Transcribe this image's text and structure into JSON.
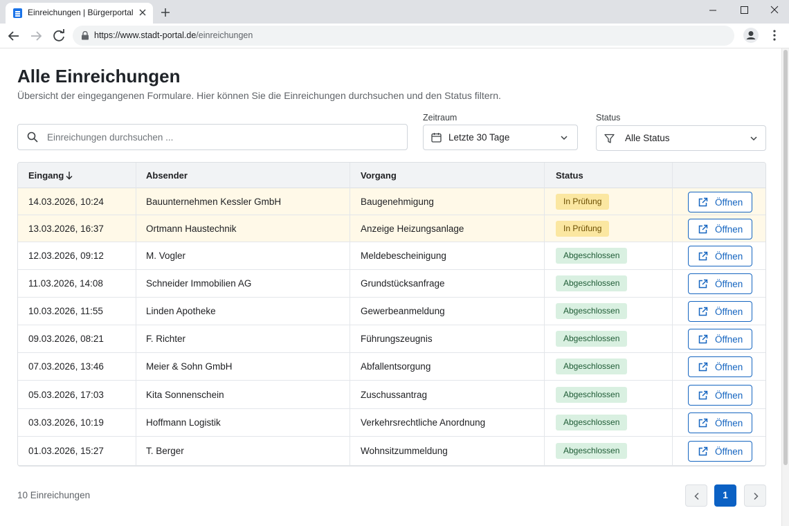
{
  "browser": {
    "tab_title": "Einreichungen | Bürgerportal",
    "url_host": "https://www.stadt-portal.de",
    "url_path": "/einreichungen"
  },
  "page": {
    "title": "Alle Einreichungen",
    "subtitle": "Übersicht der eingegangenen Formulare. Hier können Sie die Einreichungen durchsuchen und den Status filtern."
  },
  "filters": {
    "search_placeholder": "Einreichungen durchsuchen ...",
    "zeitraum_label": "Zeitraum",
    "zeitraum_value": "Letzte 30 Tage",
    "status_label": "Status",
    "status_value": "Alle Status"
  },
  "table": {
    "columns": [
      "Eingang",
      "Absender",
      "Vorgang",
      "Status"
    ],
    "open_label": "Öffnen",
    "rows": [
      {
        "date": "14.03.2026, 10:24",
        "sender": "Bauunternehmen Kessler GmbH",
        "process": "Baugenehmigung",
        "status": "In Prüfung"
      },
      {
        "date": "13.03.2026, 16:37",
        "sender": "Ortmann Haustechnik",
        "process": "Anzeige Heizungsanlage",
        "status": "In Prüfung"
      },
      {
        "date": "12.03.2026, 09:12",
        "sender": "M. Vogler",
        "process": "Meldebescheinigung",
        "status": "Abgeschlossen"
      },
      {
        "date": "11.03.2026, 14:08",
        "sender": "Schneider Immobilien AG",
        "process": "Grundstücksanfrage",
        "status": "Abgeschlossen"
      },
      {
        "date": "10.03.2026, 11:55",
        "sender": "Linden Apotheke",
        "process": "Gewerbeanmeldung",
        "status": "Abgeschlossen"
      },
      {
        "date": "09.03.2026, 08:21",
        "sender": "F. Richter",
        "process": "Führungszeugnis",
        "status": "Abgeschlossen"
      },
      {
        "date": "07.03.2026, 13:46",
        "sender": "Meier & Sohn GmbH",
        "process": "Abfallentsorgung",
        "status": "Abgeschlossen"
      },
      {
        "date": "05.03.2026, 17:03",
        "sender": "Kita Sonnenschein",
        "process": "Zuschussantrag",
        "status": "Abgeschlossen"
      },
      {
        "date": "03.03.2026, 10:19",
        "sender": "Hoffmann Logistik",
        "process": "Verkehrsrechtliche Anordnung",
        "status": "Abgeschlossen"
      },
      {
        "date": "01.03.2026, 15:27",
        "sender": "T. Berger",
        "process": "Wohnsitzummeldung",
        "status": "Abgeschlossen"
      }
    ]
  },
  "footer": {
    "count": "10 Einreichungen",
    "current_page": "1"
  },
  "colors": {
    "accent": "#1565c0",
    "pending_bg": "#fbe7a1",
    "done_bg": "#d9f0e1"
  }
}
